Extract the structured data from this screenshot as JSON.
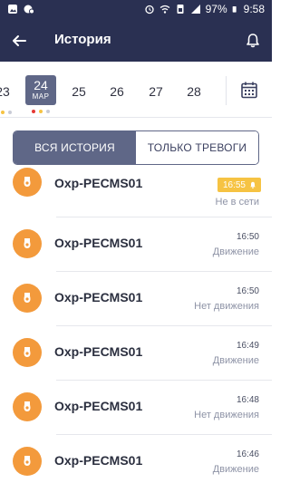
{
  "status_bar": {
    "battery": "97%",
    "time": "9:58"
  },
  "header": {
    "title": "История",
    "back_icon": "arrow-left-icon",
    "bell_icon": "bell-icon"
  },
  "dates": [
    {
      "day": "23",
      "dots": [
        "#f6c343",
        "#f6c343",
        "#c8cbd6"
      ]
    },
    {
      "day": "24",
      "month": "МАР",
      "active": true,
      "dots": [
        "#e53935",
        "#f6c343",
        "#c8cbd6"
      ]
    },
    {
      "day": "25"
    },
    {
      "day": "26"
    },
    {
      "day": "27"
    },
    {
      "day": "28"
    }
  ],
  "filter": {
    "all_label": "ВСЯ ИСТОРИЯ",
    "alarms_label": "ТОЛЬКО ТРЕВОГИ"
  },
  "events": [
    {
      "name": "Oxp-PECMS01",
      "time": "16:55",
      "status": "Не в сети",
      "alert": true
    },
    {
      "name": "Oxp-PECMS01",
      "time": "16:50",
      "status": "Движение"
    },
    {
      "name": "Oxp-PECMS01",
      "time": "16:50",
      "status": "Нет движения"
    },
    {
      "name": "Oxp-PECMS01",
      "time": "16:49",
      "status": "Движение"
    },
    {
      "name": "Oxp-PECMS01",
      "time": "16:48",
      "status": "Нет движения"
    },
    {
      "name": "Oxp-PECMS01",
      "time": "16:46",
      "status": "Движение"
    }
  ],
  "colors": {
    "header_bg": "#2a3052",
    "accent": "#5f6787",
    "avatar": "#f39a3c",
    "alert_badge": "#f6c343"
  }
}
